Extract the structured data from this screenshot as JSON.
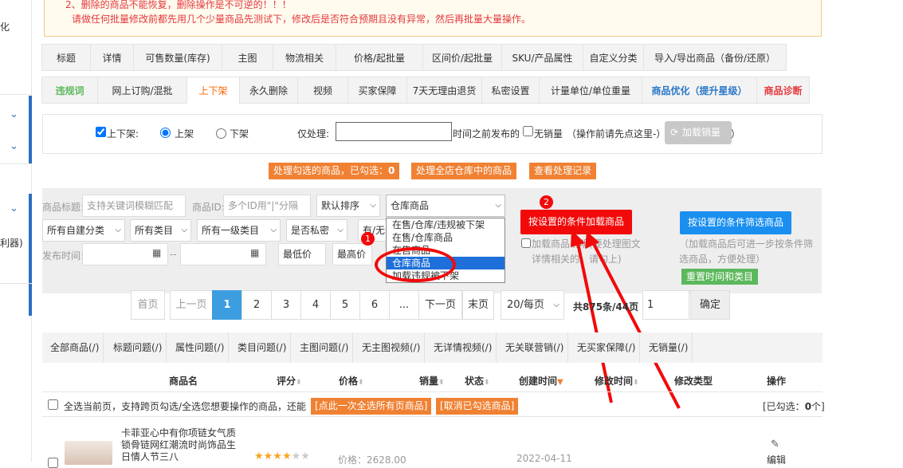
{
  "sidebar": {
    "item_1": "化",
    "item_2": "利器)"
  },
  "warning": {
    "line1": "2、删除的商品不能恢复，删除操作是不可逆的！！！",
    "line2": "请做任何批量修改前都先用几个少量商品先测试下，修改后是否符合预期且没有异常，然后再批量大量操作。"
  },
  "tabs_row1": [
    "标题",
    "详情",
    "可售数量(库存)",
    "主图",
    "物流相关",
    "价格/起批量",
    "区间价/起批量",
    "SKU/产品属性",
    "自定义分类",
    "导入/导出商品（备份/还原）"
  ],
  "tabs_row2": [
    "违规词",
    "网上订购/混批",
    "上下架",
    "永久删除",
    "视频",
    "买家保障",
    "7天无理由退货",
    "私密设置",
    "计量单位/单位重量",
    "商品优化（提升星级）",
    "商品诊断"
  ],
  "panel": {
    "checkbox_label": "上下架:",
    "radio_on": "上架",
    "radio_off": "下架",
    "only_process": "仅处理:",
    "only_process_suffix": "时间之前发布的",
    "no_sales": "无销量",
    "no_sales_hint": "（操作前请先点这里-）",
    "load_sales": "加载销量",
    "close_paren": "）"
  },
  "actions": {
    "process_selected": "处理勾选的商品，已勾选：",
    "selected_count": "0",
    "process_all": "处理全店仓库中的商品",
    "view_records": "查看处理记录"
  },
  "filters": {
    "title_label": "商品标题:",
    "title_placeholder": "支持关键词模糊匹配",
    "id_label": "商品ID:",
    "id_placeholder": "多个ID用\"|\"分隔",
    "sort": "默认排序",
    "status_select": "仓库商品",
    "status_options": [
      "在售/仓库/违规被下架",
      "在售/仓库商品",
      "在售商品",
      "仓库商品",
      "加载违规被下架"
    ],
    "status_selected_index": 3,
    "own_category": "所有自建分类",
    "category": "所有类目",
    "level1": "所有一级类目",
    "private": "是否私密",
    "has_none": "有/无",
    "publish_time": "发布时间:",
    "min_price": "最低价",
    "max_price": "最高价",
    "dash": "--"
  },
  "buttons": {
    "load_by_condition": "按设置的条件加载商品",
    "filter_by_condition": "按设置的条件筛选商品",
    "load_hint_prefix": "加载商品",
    "load_hint_rest": "说明(要处理图文详情相关的，请勾上)",
    "filter_hint": "（加载商品后可进一步按条件筛选商品，方便处理）",
    "reset": "重置时间和类目"
  },
  "badges": {
    "one": "1",
    "two": "2"
  },
  "pagination": {
    "first": "首页",
    "prev": "上一页",
    "pages": [
      "1",
      "2",
      "3",
      "4",
      "5",
      "6"
    ],
    "ellipsis": "...",
    "next": "下一页",
    "last": "末页",
    "per_page": "20/每页",
    "total": "共875条/44页",
    "jump_value": "1",
    "confirm": "确定"
  },
  "category_tabs": [
    "全部商品(/)",
    "标题问题(/)",
    "属性问题(/)",
    "类目问题(/)",
    "主图问题(/)",
    "无主图视频(/)",
    "无详情视频(/)",
    "无关联营销(/)",
    "无买家保障(/)",
    "无销量(/)"
  ],
  "table_header": {
    "name": "商品名",
    "rating": "评分",
    "price": "价格",
    "sales": "销量",
    "status": "状态",
    "created": "创建时间",
    "modified": "修改时间",
    "modify_type": "修改类型",
    "ops": "操作"
  },
  "select_row": {
    "text": "全选当前页，支持跨页勾选/全选您想要操作的商品，还能",
    "select_all_btn": "[点此一次全选所有页商品]",
    "cancel_btn": "[取消已勾选商品]",
    "selected_prefix": "[已勾选：",
    "selected_count": "0",
    "selected_suffix": "个]"
  },
  "product": {
    "title": "卡菲亚心中有你项链女气质锁骨链网红潮流时尚饰品生日情人节三八",
    "price": "价格：2628.00",
    "date": "2022-04-11",
    "edit": "编辑",
    "rating": 4
  },
  "colors": {
    "accent": "#f60",
    "orange": "#f08133",
    "red": "#f20a0a",
    "blue": "#1a8ff0",
    "green": "#5cb85c",
    "page_current": "#3c9de0"
  }
}
